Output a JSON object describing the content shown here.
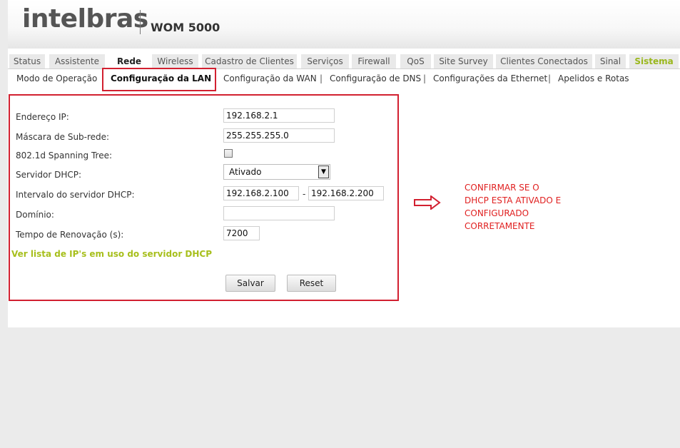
{
  "header": {
    "logo": "intelbras",
    "model": "WOM 5000"
  },
  "tabs": [
    {
      "label": "Status"
    },
    {
      "label": "Assistente"
    },
    {
      "label": "Rede"
    },
    {
      "label": "Wireless"
    },
    {
      "label": "Cadastro de Clientes"
    },
    {
      "label": "Serviços"
    },
    {
      "label": "Firewall"
    },
    {
      "label": "QoS"
    },
    {
      "label": "Site Survey"
    },
    {
      "label": "Clientes Conectados"
    },
    {
      "label": "Sinal"
    },
    {
      "label": "Sistema"
    }
  ],
  "subnav": {
    "items": [
      {
        "label": "Modo de Operação"
      },
      {
        "label": "Configuração da LAN"
      },
      {
        "label": "Configuração da WAN"
      },
      {
        "label": "Configuração de DNS"
      },
      {
        "label": "Configurações da Ethernet"
      },
      {
        "label": "Apelidos e Rotas"
      }
    ],
    "separator": "|"
  },
  "form": {
    "ip_label": "Endereço IP:",
    "ip_value": "192.168.2.1",
    "mask_label": "Máscara de Sub-rede:",
    "mask_value": "255.255.255.0",
    "stp_label": "802.1d Spanning Tree:",
    "stp_checked": false,
    "dhcp_label": "Servidor DHCP:",
    "dhcp_value": "Ativado",
    "range_label": "Intervalo do servidor DHCP:",
    "range_start": "192.168.2.100",
    "range_dash": "-",
    "range_end": "192.168.2.200",
    "domain_label": "Domínio:",
    "domain_value": "",
    "lease_label": "Tempo de Renovação (s):",
    "lease_value": "7200",
    "dhcp_list_link": "Ver lista de IP's em uso do servidor DHCP",
    "save_label": "Salvar",
    "reset_label": "Reset"
  },
  "annotation": {
    "text": "CONFIRMAR SE O\nDHCP ESTA ATIVADO E\nCONFIGURADO\nCORRETAMENTE",
    "color": "#e02020"
  },
  "colors": {
    "highlight": "#d22030",
    "accent_green": "#9ab71c"
  }
}
